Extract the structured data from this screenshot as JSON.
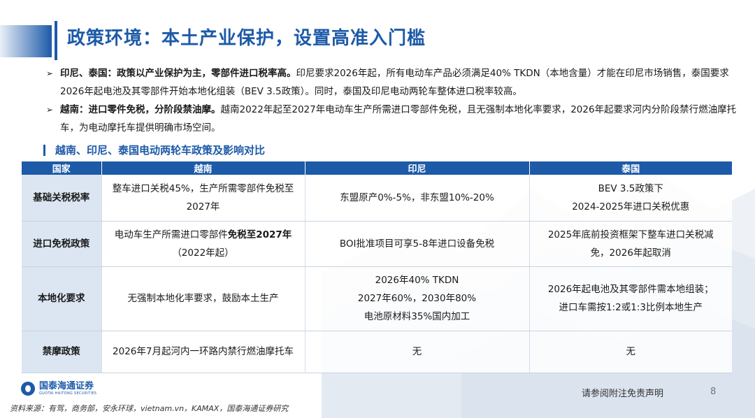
{
  "title": "政策环境：本土产业保护，设置高准入门槛",
  "bullets": [
    {
      "marker": "➢",
      "lead": "印尼、泰国：政策以产业保护为主，零部件进口税率高。",
      "text": "印尼要求2026年起，所有电动车产品必须满足40% TKDN（本地含量）才能在印尼市场销售，泰国要求2026年起电池及其零部件开始本地化组装（BEV 3.5政策）。同时，泰国及印尼电动两轮车整体进口税率较高。"
    },
    {
      "marker": "➢",
      "lead": "越南：进口零件免税，分阶段禁油摩。",
      "text": "越南2022年起至2027年电动车生产所需进口零部件免税，且无强制本地化率要求，2026年起要求河内分阶段禁行燃油摩托车，为电动摩托车提供明确市场空间。"
    }
  ],
  "section_title": "越南、印尼、泰国电动两轮车政策及影响对比",
  "table": {
    "headers": [
      "国家",
      "越南",
      "印尼",
      "泰国"
    ],
    "rows": [
      {
        "label": "基础关税税率",
        "vn": [
          "整车进口关税45%，生产所需零部件免税至2027年"
        ],
        "id": [
          "东盟原产0%-5%，非东盟10%-20%"
        ],
        "th": [
          "BEV 3.5政策下",
          "2024-2025年进口关税优惠"
        ]
      },
      {
        "label": "进口免税政策",
        "vn_pre": "电动车生产所需进口零部件",
        "vn_bold": "免税至2027年",
        "vn_post": "（2022年起）",
        "id": [
          "BOI批准项目可享5-8年进口设备免税"
        ],
        "th": [
          "2025年底前投资框架下整车进口关税减免，2026年起取消"
        ]
      },
      {
        "label": "本地化要求",
        "vn": [
          "无强制本地化率要求，鼓励本土生产"
        ],
        "id": [
          "2026年40% TKDN",
          "2027年60%，2030年80%",
          "电池原材料35%国内加工"
        ],
        "th": [
          "2026年起电池及其零部件需本地组装；",
          "进口车需按1:2或1:3比例本地生产"
        ]
      },
      {
        "label": "禁摩政策",
        "vn": [
          "2026年7月起河内一环路内禁行燃油摩托车"
        ],
        "id": [
          "无"
        ],
        "th": [
          "无"
        ]
      }
    ]
  },
  "footer": {
    "logo_cn": "国泰海通证券",
    "logo_en": "GUOTAI HAITONG SECURITIES",
    "source": "资料来源：有驾，商务部，安永环球，vietnam.vn，KAMAX，国泰海通证券研究",
    "disclaimer": "请参阅附注免责声明",
    "page": "8"
  },
  "colors": {
    "brand": "#1d5aa8",
    "row_header_bg": "#dce6f2"
  }
}
